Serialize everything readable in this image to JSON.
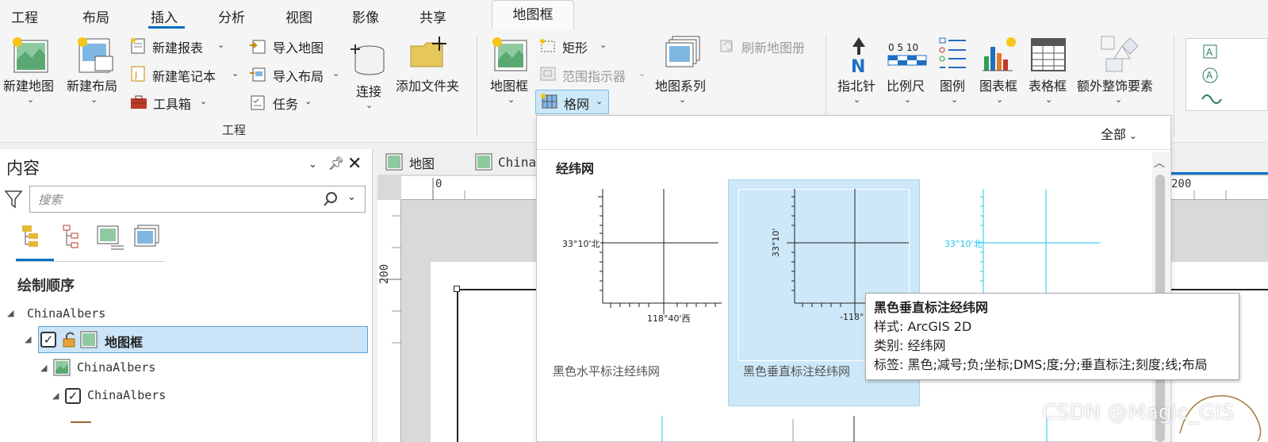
{
  "menu": {
    "tabs": [
      "工程",
      "布局",
      "插入",
      "分析",
      "视图",
      "影像",
      "共享"
    ],
    "active": "插入",
    "context_tab": "地图框"
  },
  "ribbon": {
    "project_group": {
      "label": "工程",
      "new_map": "新建地图",
      "new_layout": "新建布局",
      "new_report": "新建报表",
      "new_notebook": "新建笔记本",
      "toolbox": "工具箱",
      "import_map": "导入地图",
      "import_layout": "导入布局",
      "task": "任务",
      "connect": "连接",
      "add_folder": "添加文件夹"
    },
    "map_frames_group": {
      "map_frame": "地图框",
      "rectangle": "矩形",
      "extent_indicator": "范围指示器",
      "grid": "格网",
      "map_series": "地图系列",
      "refresh_map_series": "刷新地图册"
    },
    "surround_group": {
      "north_arrow": "指北针",
      "scale_bar": "比例尺",
      "legend": "图例",
      "chart_frame": "图表框",
      "table_frame": "表格框",
      "more_surrounds": "额外整饰要素",
      "scale_ticks": "0 5 10"
    }
  },
  "contents_panel": {
    "title": "内容",
    "search_placeholder": "搜索",
    "section": "绘制顺序",
    "tree": [
      {
        "label": "ChinaAlbers"
      },
      {
        "label": "地图框"
      },
      {
        "label": "ChinaAlbers"
      },
      {
        "label": "ChinaAlbers"
      }
    ]
  },
  "views": {
    "tabs": [
      "地图",
      "ChinaA"
    ],
    "ruler_h": [
      "0",
      "200"
    ],
    "ruler_v": [
      "200"
    ]
  },
  "gallery": {
    "filter": "全部",
    "section": "经纬网",
    "items": [
      {
        "name": "黑色水平标注经纬网",
        "lat": "33°10'北",
        "lon": "118°40'西"
      },
      {
        "name": "黑色垂直标注经纬网",
        "lat": "33°10'",
        "lon": "-118°"
      },
      {
        "name": "",
        "lat": "33°10'北",
        "lon": ""
      }
    ]
  },
  "tooltip": {
    "title": "黑色垂直标注经纬网",
    "style": "样式:  ArcGIS 2D",
    "category": "类别:  经纬网",
    "tags": "标签:  黑色;减号;负;坐标;DMS;度;分;垂直标注;刻度;线;布局"
  },
  "watermark": "CSDN @Magic_GIS",
  "colors": {
    "accent": "#0a6ec8",
    "selection": "#cde8f8",
    "cyan_grid": "#1fc8f0"
  }
}
